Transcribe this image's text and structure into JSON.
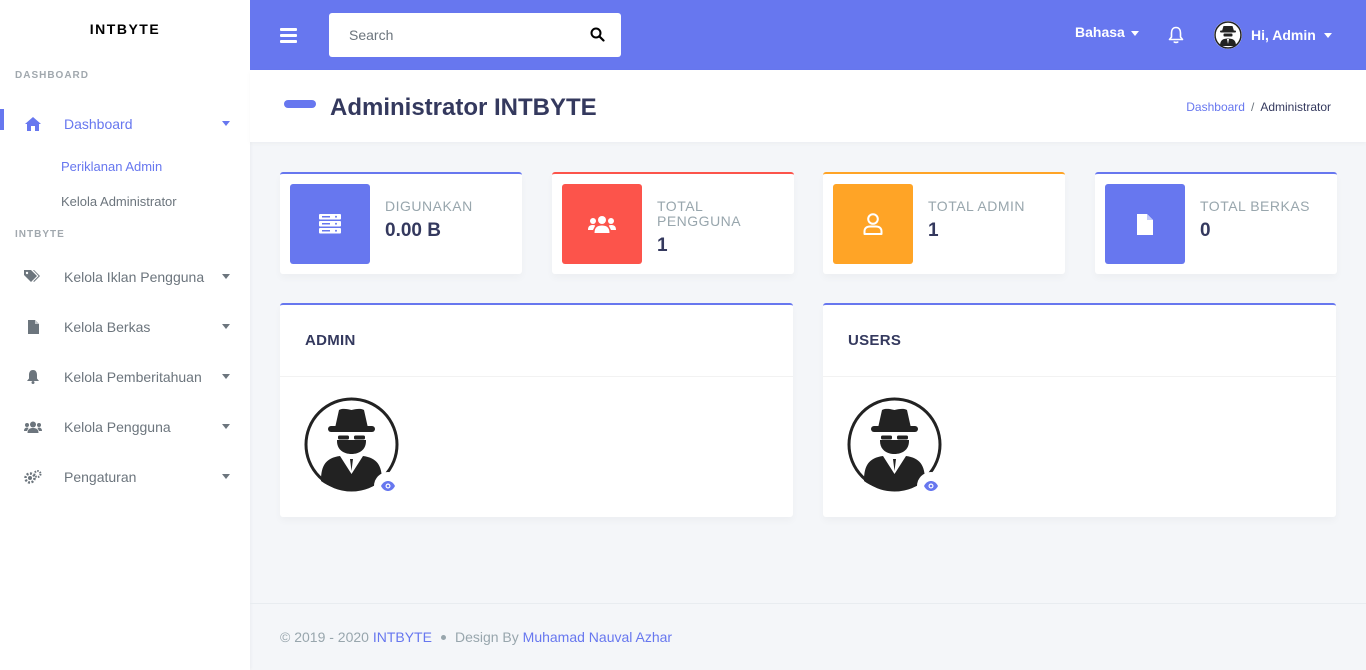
{
  "sidebar": {
    "brand": "INTBYTE",
    "header_dashboard": "DASHBOARD",
    "dashboard_label": "Dashboard",
    "sub_items": [
      "Periklanan Admin",
      "Kelola Administrator"
    ],
    "header_intbyte": "INTBYTE",
    "items": [
      {
        "label": "Kelola Iklan Pengguna",
        "icon": "tags-icon"
      },
      {
        "label": "Kelola Berkas",
        "icon": "file-icon"
      },
      {
        "label": "Kelola Pemberitahuan",
        "icon": "bell-icon"
      },
      {
        "label": "Kelola Pengguna",
        "icon": "users-icon"
      },
      {
        "label": "Pengaturan",
        "icon": "cogs-icon"
      }
    ]
  },
  "navbar": {
    "search_placeholder": "Search",
    "language": "Bahasa",
    "user_greeting": "Hi, Admin"
  },
  "header": {
    "title": "Administrator INTBYTE",
    "breadcrumb": [
      "Dashboard",
      "Administrator"
    ]
  },
  "stats": [
    {
      "label": "DIGUNAKAN",
      "value": "0.00 B",
      "color": "#6777ef",
      "icon": "server-icon"
    },
    {
      "label": "TOTAL PENGGUNA",
      "value": "1",
      "color": "#fc544b",
      "icon": "users-icon"
    },
    {
      "label": "TOTAL ADMIN",
      "value": "1",
      "color": "#ffa426",
      "icon": "user-icon"
    },
    {
      "label": "TOTAL BERKAS",
      "value": "0",
      "color": "#6777ef",
      "icon": "file-icon"
    }
  ],
  "cards": [
    {
      "title": "ADMIN"
    },
    {
      "title": "USERS"
    }
  ],
  "footer": {
    "copyright": "© 2019 - 2020",
    "brand_link": "INTBYTE",
    "design_by": "Design By",
    "author": "Muhamad Nauval Azhar"
  },
  "colors": {
    "primary": "#6777ef",
    "danger": "#fc544b",
    "warning": "#ffa426"
  }
}
